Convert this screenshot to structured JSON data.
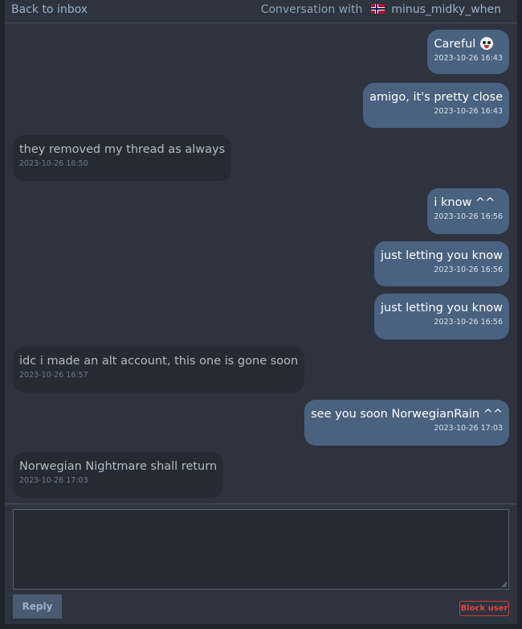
{
  "header": {
    "back_label": "Back to inbox",
    "conversation_prefix": "Conversation with",
    "username": "minus_midky_when",
    "flag_icon": "norway-flag-icon"
  },
  "messages": [
    {
      "direction": "out",
      "text": "Careful",
      "time": "2023-10-26 16:43",
      "emoji_icon": "skull-tongue-emoji-icon"
    },
    {
      "direction": "out",
      "text": "amigo, it's pretty close",
      "time": "2023-10-26 16:43"
    },
    {
      "direction": "in",
      "text": "they removed my thread as always",
      "time": "2023-10-26 16:50"
    },
    {
      "direction": "out",
      "text": "i know ^^",
      "time": "2023-10-26 16:56"
    },
    {
      "direction": "out",
      "text": "just letting you know",
      "time": "2023-10-26 16:56"
    },
    {
      "direction": "out",
      "text": "just letting you know",
      "time": "2023-10-26 16:56"
    },
    {
      "direction": "in",
      "text": "idc i made an alt account, this one is gone soon",
      "time": "2023-10-26 16:57"
    },
    {
      "direction": "out",
      "text": "see you soon NorwegianRain ^^",
      "time": "2023-10-26 17:03"
    },
    {
      "direction": "in",
      "text": "Norwegian Nightmare shall return",
      "time": "2023-10-26 17:03"
    }
  ],
  "composer": {
    "value": "",
    "reply_label": "Reply",
    "block_label": "Block user"
  },
  "colors": {
    "outgoing_bubble": "#4a6180",
    "incoming_bubble": "#242b34",
    "danger": "#e04444",
    "link": "#9fb2c9"
  }
}
